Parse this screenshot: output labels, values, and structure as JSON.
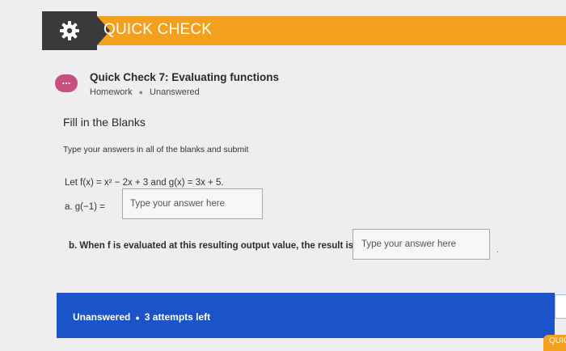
{
  "banner": {
    "title": "QUICK CHECK",
    "icon": "gear-icon"
  },
  "quick_check": {
    "badge": "...",
    "title": "Quick Check 7: Evaluating functions",
    "category": "Homework",
    "status": "Unanswered"
  },
  "question": {
    "heading": "Fill in the Blanks",
    "instructions": "Type your answers in all of the blanks and submit",
    "problem": "Let f(x) = x² − 2x + 3 and g(x) = 3x + 5.",
    "part_a_label": "a. g(−1) =",
    "part_a_placeholder": "Type your answer here",
    "part_b_label": "b. When f is evaluated at this resulting output value, the result is",
    "part_b_placeholder": "Type your answer here",
    "part_b_suffix": "."
  },
  "footer": {
    "status": "Unanswered",
    "attempts": "3 attempts left",
    "corner_button": "QUIC"
  },
  "colors": {
    "accent": "#f2a01e",
    "footer": "#1a54c8",
    "dark": "#3a3a3c",
    "badge": "#c8507f"
  }
}
